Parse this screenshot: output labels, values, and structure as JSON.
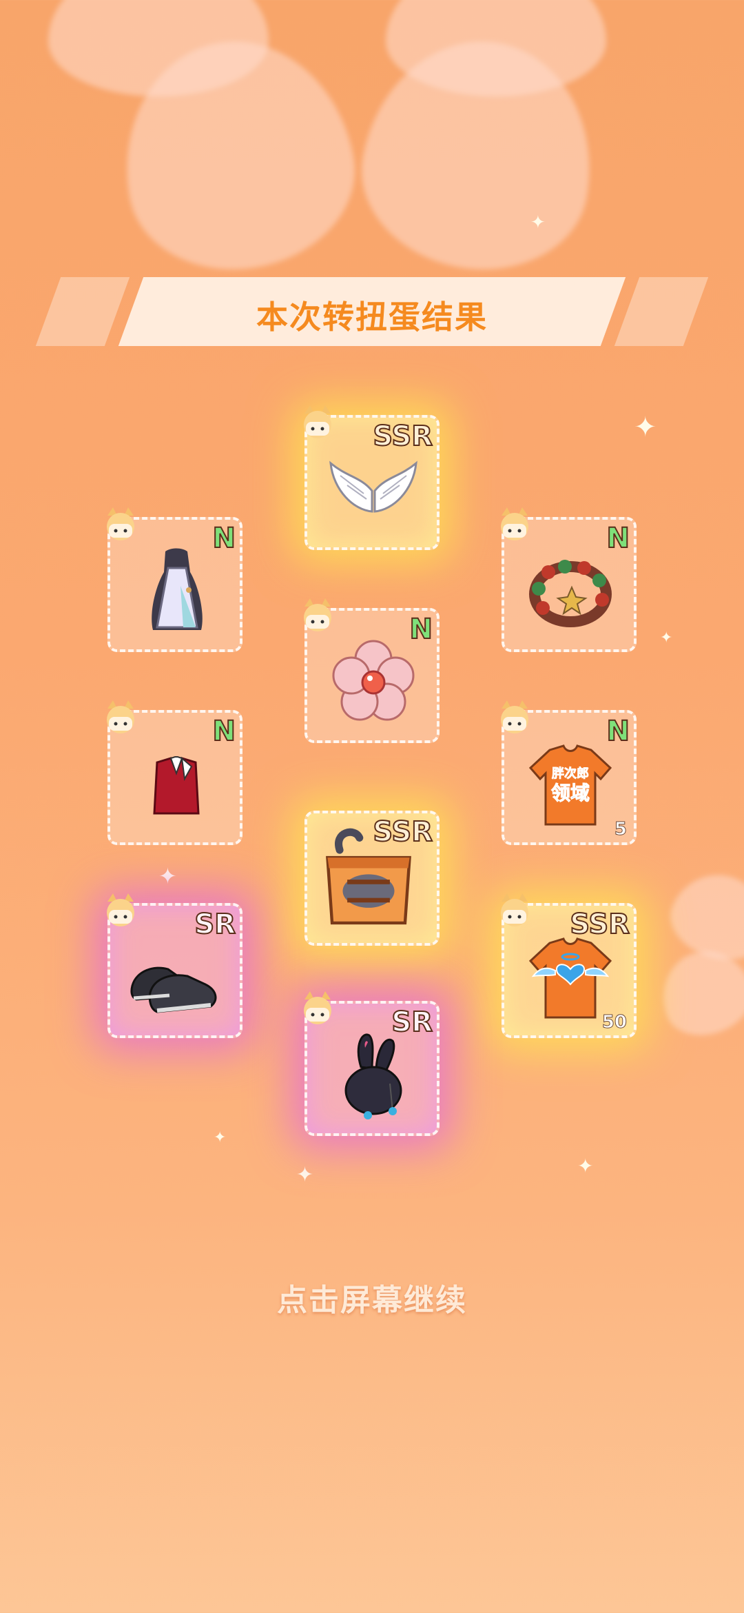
{
  "title": "本次转扭蛋结果",
  "continue_text": "点击屏幕继续",
  "items": [
    {
      "rarity": "SSR",
      "name": "wings",
      "qty": ""
    },
    {
      "rarity": "N",
      "name": "white-dress",
      "qty": ""
    },
    {
      "rarity": "N",
      "name": "bead-bracelet",
      "qty": ""
    },
    {
      "rarity": "N",
      "name": "pink-flower",
      "qty": ""
    },
    {
      "rarity": "N",
      "name": "red-vest",
      "qty": ""
    },
    {
      "rarity": "N",
      "name": "orange-tshirt",
      "qty": "5"
    },
    {
      "rarity": "SSR",
      "name": "cat-box",
      "qty": ""
    },
    {
      "rarity": "SR",
      "name": "black-sneakers",
      "qty": ""
    },
    {
      "rarity": "SSR",
      "name": "angel-heart-tshirt",
      "qty": "50"
    },
    {
      "rarity": "SR",
      "name": "bunny-ear-hat",
      "qty": ""
    }
  ],
  "tshirt_print": [
    "胖次郎",
    "领域"
  ],
  "colors": {
    "accent": "#f58a1f",
    "bg_top": "#f8a56a",
    "bg_bottom": "#fdc696",
    "n_rarity": "#7fe07a"
  }
}
